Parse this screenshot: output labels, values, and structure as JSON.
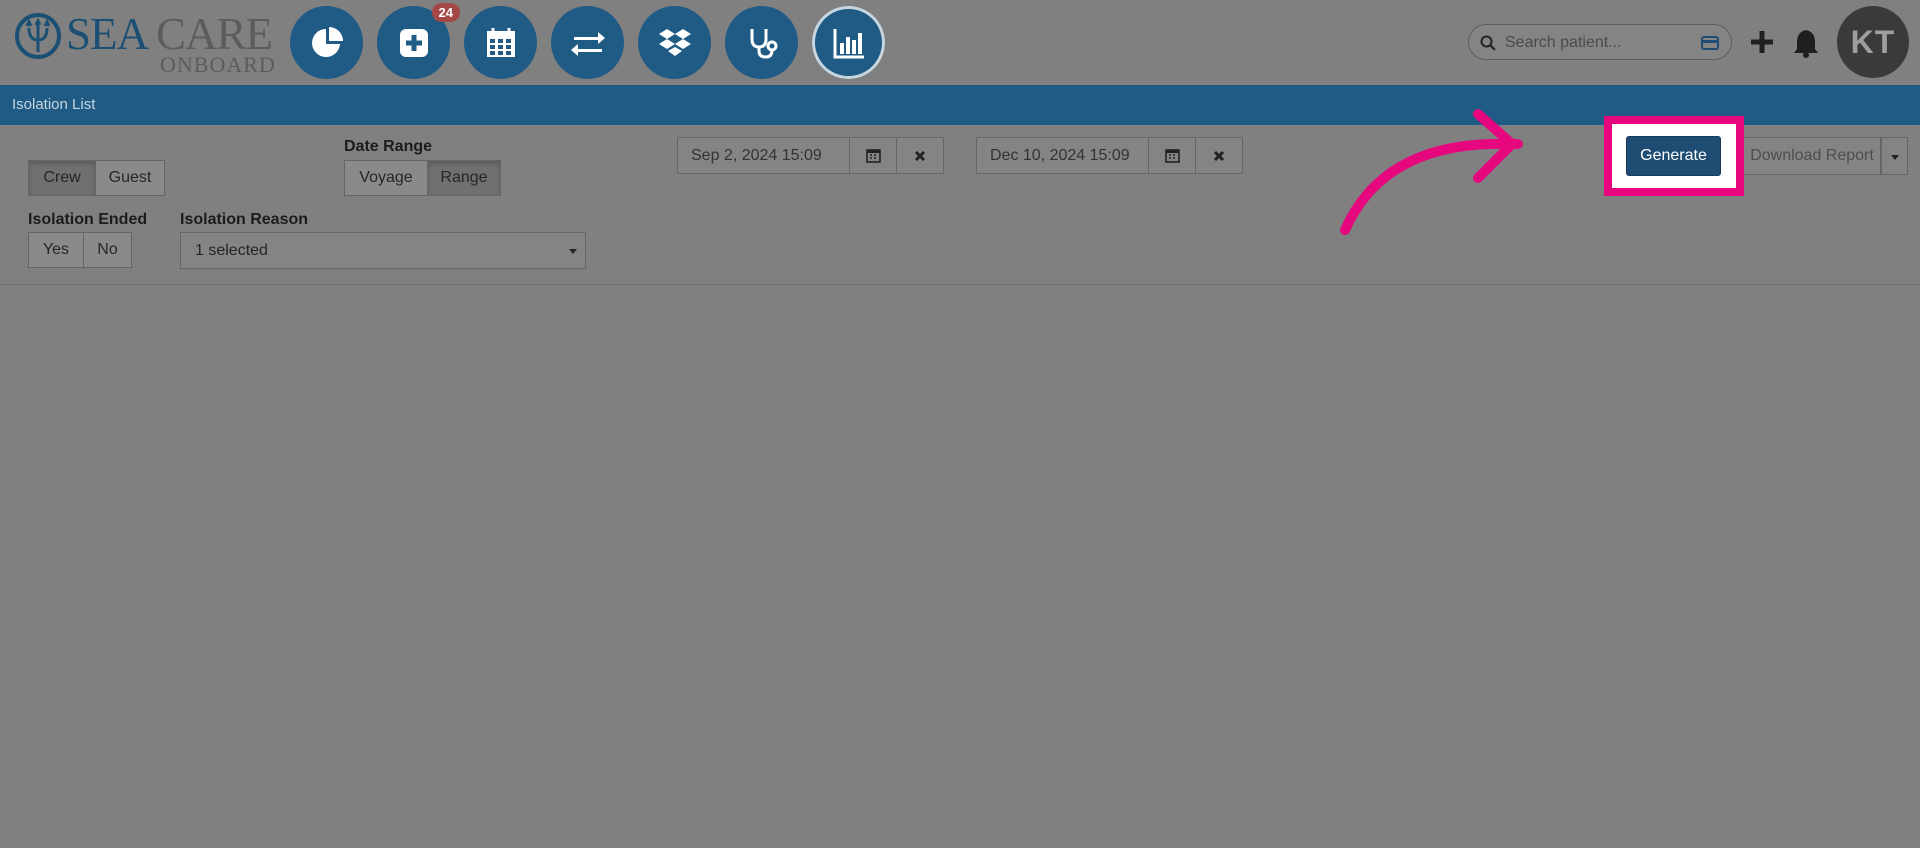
{
  "header": {
    "logo": {
      "sea": "SEA",
      "care": "CARE",
      "onboard": "ONBOARD"
    },
    "nav": [
      {
        "icon": "pie-chart-icon"
      },
      {
        "icon": "medical-plus-icon",
        "badge": "24"
      },
      {
        "icon": "calendar-icon"
      },
      {
        "icon": "transfer-arrows-icon"
      },
      {
        "icon": "dropbox-icon"
      },
      {
        "icon": "stethoscope-icon"
      },
      {
        "icon": "bar-chart-icon"
      }
    ],
    "search_placeholder": "Search patient...",
    "avatar_initials": "KT"
  },
  "page_title": "Isolation List",
  "filters": {
    "patient_type": {
      "options": [
        "Crew",
        "Guest"
      ],
      "selected": "Crew"
    },
    "date_range": {
      "label": "Date Range",
      "options": [
        "Voyage",
        "Range"
      ],
      "selected": "Range"
    },
    "start_date": "Sep 2, 2024 15:09",
    "end_date": "Dec 10, 2024 15:09",
    "isolation_ended": {
      "label": "Isolation Ended",
      "options": [
        "Yes",
        "No"
      ]
    },
    "isolation_reason": {
      "label": "Isolation Reason",
      "value": "1 selected"
    }
  },
  "actions": {
    "generate": "Generate",
    "download": "Download Report"
  },
  "colors": {
    "brand": "#1f5b84",
    "highlight": "#e6077f",
    "overlay": "#808080"
  }
}
